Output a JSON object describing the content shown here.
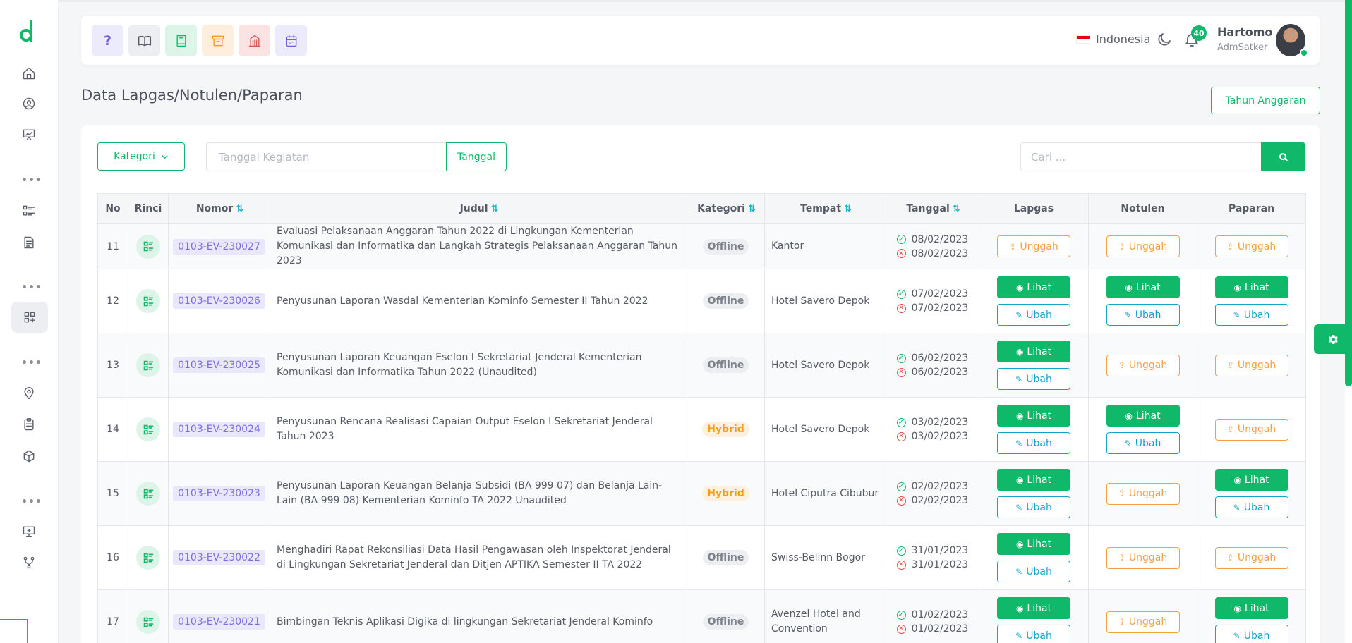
{
  "header": {
    "language": "Indonesia",
    "notification_count": "40",
    "user_name": "Hartomo",
    "user_role": "AdmSatker",
    "quick_buttons": [
      {
        "name": "help-icon",
        "bg": "#ecebfb",
        "color": "#6c63d9"
      },
      {
        "name": "book-open-icon",
        "bg": "#eceef1",
        "color": "#555a65"
      },
      {
        "name": "book-icon",
        "bg": "#dcf5e8",
        "color": "#10b969"
      },
      {
        "name": "archive-icon",
        "bg": "#fdeedd",
        "color": "#f59e1c"
      },
      {
        "name": "building-icon",
        "bg": "#fbe3e3",
        "color": "#e25555"
      },
      {
        "name": "calendar-icon",
        "bg": "#ecebfb",
        "color": "#6c63d9"
      }
    ],
    "help_glyph": "?"
  },
  "page": {
    "title": "Data Lapgas/Notulen/Paparan",
    "tahun_button": "Tahun Anggaran"
  },
  "filters": {
    "kategori_label": "Kategori",
    "date_placeholder": "Tanggal Kegiatan",
    "date_button": "Tanggal",
    "search_placeholder": "Cari ..."
  },
  "table": {
    "headers": {
      "no": "No",
      "rinci": "Rinci",
      "nomor": "Nomor",
      "judul": "Judul",
      "kategori": "Kategori",
      "tempat": "Tempat",
      "tanggal": "Tanggal",
      "lapgas": "Lapgas",
      "notulen": "Notulen",
      "paparan": "Paparan"
    },
    "button_labels": {
      "unggah": "Unggah",
      "lihat": "Lihat",
      "ubah": "Ubah"
    },
    "rows": [
      {
        "no": "11",
        "nomor": "0103-EV-230027",
        "judul": "Evaluasi Pelaksanaan Anggaran Tahun 2022 di Lingkungan Kementerian Komunikasi dan Informatika dan Langkah Strategis Pelaksanaan Anggaran Tahun 2023",
        "kategori": "Offline",
        "tempat": "Kantor",
        "tgl_mulai": "08/02/2023",
        "tgl_selesai": "08/02/2023",
        "lapgas": "unggah",
        "notulen": "unggah",
        "paparan": "unggah"
      },
      {
        "no": "12",
        "nomor": "0103-EV-230026",
        "judul": "Penyusunan Laporan Wasdal Kementerian Kominfo Semester II Tahun 2022",
        "kategori": "Offline",
        "tempat": "Hotel Savero Depok",
        "tgl_mulai": "07/02/2023",
        "tgl_selesai": "07/02/2023",
        "lapgas": "lihat",
        "notulen": "lihat",
        "paparan": "lihat"
      },
      {
        "no": "13",
        "nomor": "0103-EV-230025",
        "judul": "Penyusunan Laporan Keuangan Eselon I Sekretariat Jenderal Kementerian Komunikasi dan Informatika Tahun 2022 (Unaudited)",
        "kategori": "Offline",
        "tempat": "Hotel Savero Depok",
        "tgl_mulai": "06/02/2023",
        "tgl_selesai": "06/02/2023",
        "lapgas": "lihat",
        "notulen": "unggah",
        "paparan": "unggah"
      },
      {
        "no": "14",
        "nomor": "0103-EV-230024",
        "judul": "Penyusunan Rencana Realisasi Capaian Output Eselon I Sekretariat Jenderal Tahun 2023",
        "kategori": "Hybrid",
        "tempat": "Hotel Savero Depok",
        "tgl_mulai": "03/02/2023",
        "tgl_selesai": "03/02/2023",
        "lapgas": "lihat",
        "notulen": "lihat",
        "paparan": "unggah"
      },
      {
        "no": "15",
        "nomor": "0103-EV-230023",
        "judul": "Penyusunan Laporan Keuangan Belanja Subsidi (BA 999 07) dan Belanja Lain-Lain (BA 999 08) Kementerian Kominfo TA 2022 Unaudited",
        "kategori": "Hybrid",
        "tempat": "Hotel Ciputra Cibubur",
        "tgl_mulai": "02/02/2023",
        "tgl_selesai": "02/02/2023",
        "lapgas": "lihat",
        "notulen": "unggah",
        "paparan": "lihat"
      },
      {
        "no": "16",
        "nomor": "0103-EV-230022",
        "judul": "Menghadiri Rapat Rekonsiliasi Data Hasil Pengawasan oleh Inspektorat Jenderal di Lingkungan Sekretariat Jenderal dan Ditjen APTIKA Semester II TA 2022",
        "kategori": "Offline",
        "tempat": "Swiss-Belinn Bogor",
        "tgl_mulai": "31/01/2023",
        "tgl_selesai": "31/01/2023",
        "lapgas": "lihat",
        "notulen": "unggah",
        "paparan": "unggah"
      },
      {
        "no": "17",
        "nomor": "0103-EV-230021",
        "judul": "Bimbingan Teknis Aplikasi Digika di lingkungan Sekretariat Jenderal Kominfo",
        "kategori": "Offline",
        "tempat": "Avenzel Hotel and Convention",
        "tgl_mulai": "01/02/2023",
        "tgl_selesai": "01/02/2023",
        "lapgas": "lihat",
        "notulen": "unggah",
        "paparan": "lihat"
      }
    ]
  },
  "colors": {
    "accent": "#10b969",
    "warning": "#f5a143",
    "info": "#16a3c9"
  }
}
